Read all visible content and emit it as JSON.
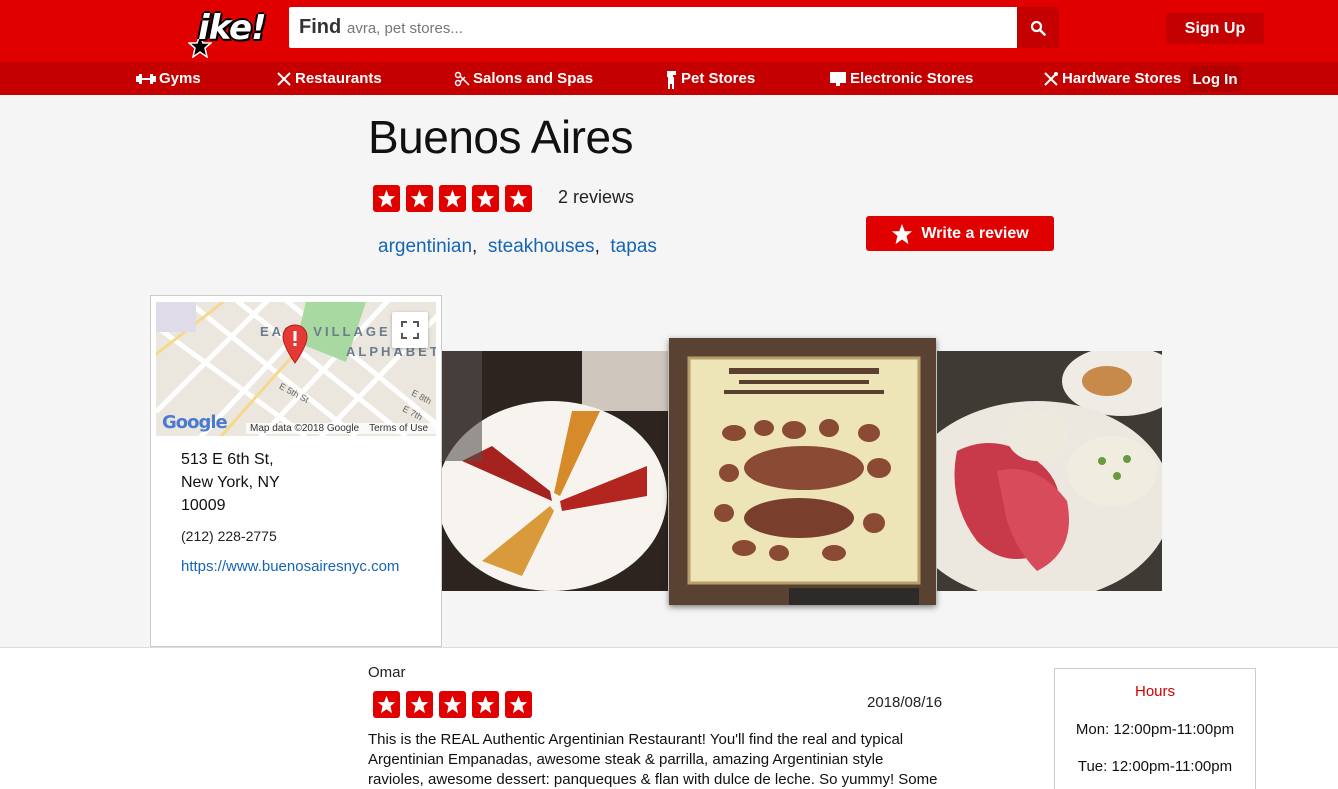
{
  "header": {
    "logo_text": "ike!",
    "search_label": "Find",
    "search_placeholder": "avra, pet stores...",
    "signup_label": "Sign Up",
    "login_label": "Log In",
    "brand_color": "#e00000"
  },
  "nav": {
    "items": [
      {
        "label": "Gyms",
        "icon": "dumbbell-icon"
      },
      {
        "label": "Restaurants",
        "icon": "utensils-icon"
      },
      {
        "label": "Salons and Spas",
        "icon": "scissors-icon"
      },
      {
        "label": "Pet Stores",
        "icon": "dog-icon"
      },
      {
        "label": "Electronic Stores",
        "icon": "monitor-icon"
      },
      {
        "label": "Hardware Stores",
        "icon": "tools-icon"
      }
    ]
  },
  "business": {
    "name": "Buenos Aires",
    "rating": 5,
    "review_count_text": "2 reviews",
    "categories": [
      "argentinian",
      "steakhouses",
      "tapas"
    ],
    "write_review_label": "Write a review",
    "address_line1": "513 E 6th St,",
    "address_line2": "New York, NY",
    "address_line3": "10009",
    "phone": "(212) 228-2775",
    "website": "https://www.buenosairesnyc.com"
  },
  "map": {
    "area_label_1": "EAST VILLAGE",
    "area_label_2": "ALPHABET",
    "street_1": "E 5th St",
    "street_2": "E 8th",
    "street_3": "E 7th",
    "google_text": "Google",
    "data_credit": "Map data ©2018 Google",
    "terms": "Terms of Use"
  },
  "review": {
    "author": "Omar",
    "rating": 5,
    "date": "2018/08/16",
    "text": "This is the REAL Authentic Argentinian Restaurant! You'll find the real and typical Argentinian Empanadas, awesome steak & parrilla, amazing Argentinian style ravioles, awesome dessert: panqueques & flan with dulce de leche. So yummy! Some other"
  },
  "hours": {
    "title": "Hours",
    "rows": [
      {
        "text": "Mon: 12:00pm-11:00pm"
      },
      {
        "text": "Tue: 12:00pm-11:00pm"
      }
    ]
  }
}
